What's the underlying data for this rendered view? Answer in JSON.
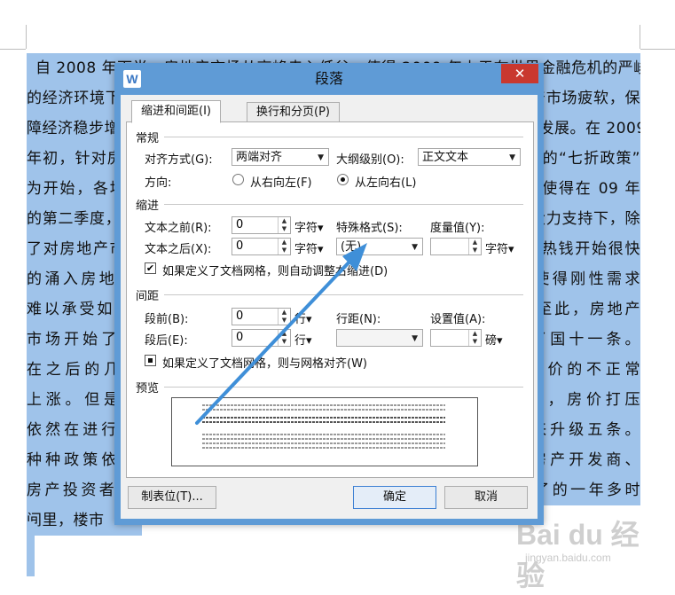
{
  "document": {
    "lines": [
      "自 2008 年下半，房地产市场从高峰走入低谷，使得 2009 年上于在世界金融危机的严峻",
      "的经济环境下，国家为了刺激国内需求，采取了一系列措施救市，在房地产市场疲软，保",
      "障经济稳步增长的背景下，政府先后出台了一系列政策来促进房地产市场的发展。在 2009",
      "年初，针对房地产市场低迷的情况，政府推出了一系列救市政策，以所谓的“七折政策”",
      "为开始，各地方政府纷纷出台了购房补贴等一系列刺激政策，这些措施使得在 09 年",
      "的第二季度，房地产市场逐渐回暖，在宽松的货币政策和积极的财政政策大力支持下，除",
      "了对房地产市场进行扶持外，大量的信贷资金也开始流入市场，大量的热钱开始很快",
      "的涌入房地产市场，房价在短时间内迅速攀升，房价的快速上涨使得刚性需求",
      "难以承受如此高的房价，政府又开始着手对房地产市场进行调控，至此，房地产",
      "市场开始了新一轮的调控，2010 年 1 月，国务院办公厅发布了国十一条。",
      "在之后的几个月里，政府又陆续出台了一系列的政策来遏制房价的不正常",
      "上涨。但是由于各种原因，房价依然居高不下，到了 2010 年，房价打压",
      "依然在进行，政府又出台了新国十条，从原来的国十一条到后来升级五条。",
      "种种政策依然没有让房价出现下降的趋势，反而是越调越涨，房产开发商、",
      "房产投资者也纷纷表示对政策的不理解，在政策频出的将近一年了的一年多时",
      "间里，楼市"
    ]
  },
  "dialog": {
    "title": "段落",
    "close_label": "✕",
    "app_logo": "W",
    "tabs": [
      {
        "label": "缩进和间距(I)",
        "active": true
      },
      {
        "label": "换行和分页(P)",
        "active": false
      }
    ],
    "general": {
      "heading": "常规",
      "alignment_label": "对齐方式(G):",
      "alignment_value": "两端对齐",
      "outline_label": "大纲级别(O):",
      "outline_value": "正文文本",
      "direction_label": "方向:",
      "rtl_label": "从右向左(F)",
      "ltr_label": "从左向右(L)",
      "direction_selected": "ltr"
    },
    "indent": {
      "heading": "缩进",
      "before_label": "文本之前(R):",
      "before_value": "0",
      "before_unit": "字符▾",
      "after_label": "文本之后(X):",
      "after_value": "0",
      "after_unit": "字符▾",
      "special_label": "特殊格式(S):",
      "special_value": "(无)",
      "measure_label": "度量值(Y):",
      "measure_value": "",
      "measure_unit": "字符▾",
      "auto_adjust_label": "如果定义了文档网格，则自动调整右缩进(D)",
      "auto_adjust_checked": true
    },
    "spacing": {
      "heading": "间距",
      "before_label": "段前(B):",
      "before_value": "0",
      "before_unit": "行▾",
      "after_label": "段后(E):",
      "after_value": "0",
      "after_unit": "行▾",
      "line_label": "行距(N):",
      "line_value": "",
      "setting_label": "设置值(A):",
      "setting_value": "",
      "setting_unit": "磅▾",
      "grid_align_label": "如果定义了文档网格，则与网格对齐(W)",
      "grid_align_checked": true
    },
    "preview": {
      "heading": "预览"
    },
    "buttons": {
      "tabs_label": "制表位(T)...",
      "ok_label": "确定",
      "cancel_label": "取消"
    }
  },
  "watermark": {
    "main": "Bai du 经验",
    "sub": "jingyan.baidu.com"
  },
  "colors": {
    "selection": "#9fc3ea",
    "titlebar": "#5f9bd6",
    "close": "#c9382f",
    "arrow": "#3f8fd8"
  }
}
